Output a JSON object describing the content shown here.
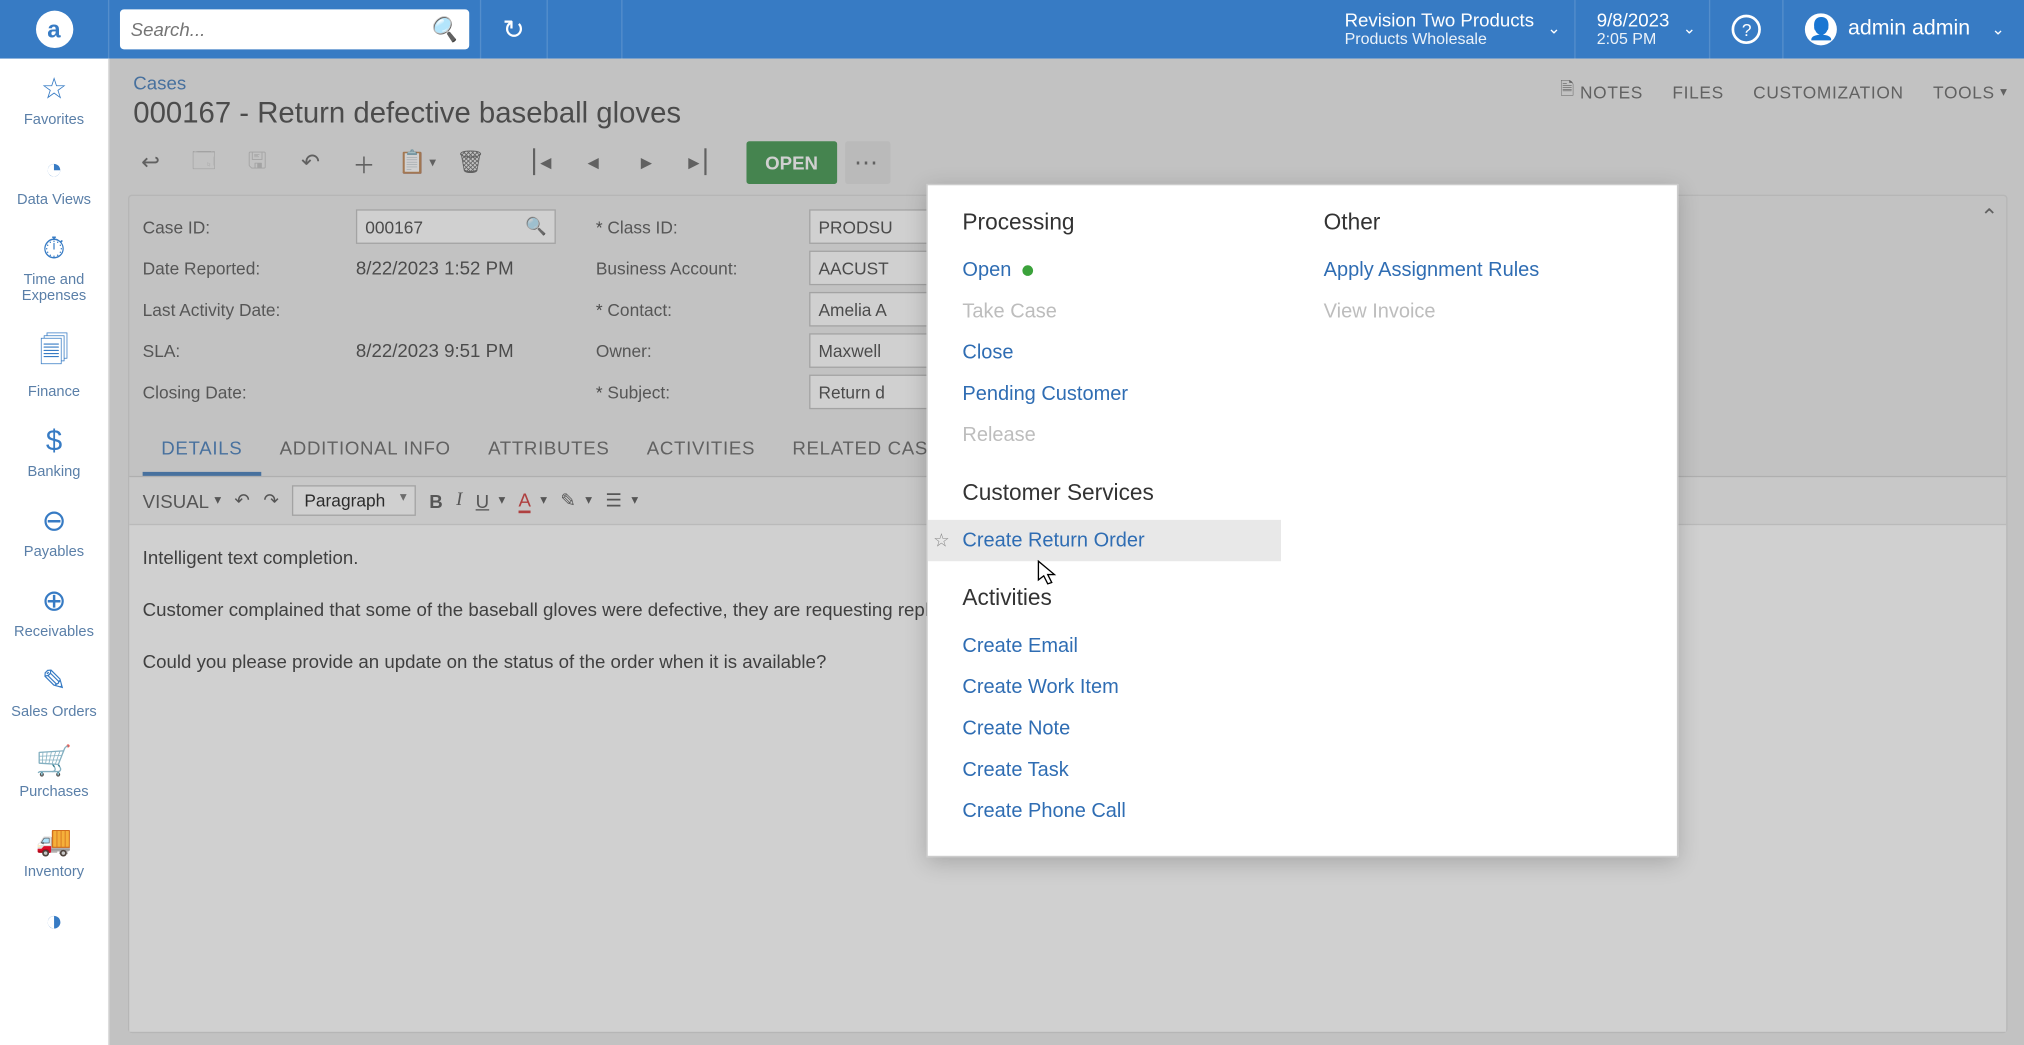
{
  "topbar": {
    "search_placeholder": "Search...",
    "company_line1": "Revision Two Products",
    "company_line2": "Products Wholesale",
    "date": "9/8/2023",
    "time": "2:05 PM",
    "username": "admin admin"
  },
  "leftrail": {
    "items": [
      {
        "icon": "☆",
        "label": "Favorites"
      },
      {
        "icon": "◔",
        "label": "Data Views"
      },
      {
        "icon": "⏱",
        "label": "Time and Expenses"
      },
      {
        "icon": "🗐",
        "label": "Finance"
      },
      {
        "icon": "$",
        "label": "Banking"
      },
      {
        "icon": "⊖",
        "label": "Payables"
      },
      {
        "icon": "⊕",
        "label": "Receivables"
      },
      {
        "icon": "✎",
        "label": "Sales Orders"
      },
      {
        "icon": "🛒",
        "label": "Purchases"
      },
      {
        "icon": "🚚",
        "label": "Inventory"
      },
      {
        "icon": "◑",
        "label": ""
      }
    ]
  },
  "header": {
    "crumb": "Cases",
    "title": "000167 - Return defective baseball gloves",
    "actions": {
      "notes": "NOTES",
      "files": "FILES",
      "customization": "CUSTOMIZATION",
      "tools": "TOOLS"
    }
  },
  "toolbar": {
    "status": "OPEN"
  },
  "form": {
    "col1": {
      "case_id_label": "Case ID:",
      "case_id": "000167",
      "date_reported_label": "Date Reported:",
      "date_reported": "8/22/2023 1:52 PM",
      "last_activity_label": "Last Activity Date:",
      "sla_label": "SLA:",
      "sla": "8/22/2023 9:51 PM",
      "closing_label": "Closing Date:"
    },
    "col2": {
      "class_label": "Class ID:",
      "class": "PRODSU",
      "ba_label": "Business Account:",
      "ba": "AACUST",
      "contact_label": "Contact:",
      "contact": "Amelia A",
      "owner_label": "Owner:",
      "owner": "Maxwell",
      "subject_label": "Subject:",
      "subject": "Return d"
    }
  },
  "tabs": {
    "t0": "DETAILS",
    "t1": "ADDITIONAL INFO",
    "t2": "ATTRIBUTES",
    "t3": "ACTIVITIES",
    "t4": "RELATED CASES"
  },
  "editor": {
    "visual": "VISUAL",
    "paragraph": "Paragraph",
    "body1": "Intelligent text completion.",
    "body2": "Customer complained that some of the baseball gloves were defective, they are requesting replac",
    "body3": "Could you please provide an update on the status of the order when it is available?"
  },
  "menu": {
    "processing_h": "Processing",
    "open": "Open",
    "take_case": "Take Case",
    "close": "Close",
    "pending": "Pending Customer",
    "release": "Release",
    "cs_h": "Customer Services",
    "create_return": "Create Return Order",
    "activities_h": "Activities",
    "create_email": "Create Email",
    "create_work": "Create Work Item",
    "create_note": "Create Note",
    "create_task": "Create Task",
    "create_phone": "Create Phone Call",
    "other_h": "Other",
    "apply_rules": "Apply Assignment Rules",
    "view_invoice": "View Invoice"
  }
}
